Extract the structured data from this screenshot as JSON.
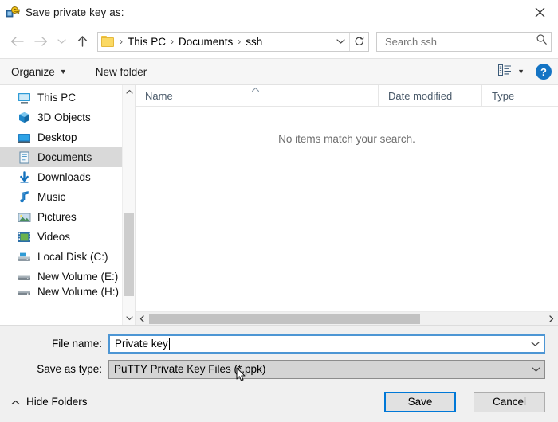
{
  "window": {
    "title": "Save private key as:",
    "icon": "key-icon",
    "close_label": "✕"
  },
  "nav": {
    "back": "←",
    "forward": "→",
    "recent": "⌄",
    "up": "↑",
    "refresh": "⟳",
    "dropdown": "⌄"
  },
  "breadcrumb": {
    "items": [
      "This PC",
      "Documents",
      "ssh"
    ],
    "separator": "›"
  },
  "search": {
    "placeholder": "Search ssh",
    "value": "",
    "icon": "search-icon"
  },
  "toolbar": {
    "organize_label": "Organize",
    "organize_caret": "▾",
    "new_folder_label": "New folder",
    "view_caret": "▾",
    "help_label": "?"
  },
  "sidebar": {
    "items": [
      {
        "label": "This PC",
        "icon": "monitor-icon",
        "selected": false
      },
      {
        "label": "3D Objects",
        "icon": "cube-icon",
        "selected": false
      },
      {
        "label": "Desktop",
        "icon": "desktop-icon",
        "selected": false
      },
      {
        "label": "Documents",
        "icon": "document-icon",
        "selected": true
      },
      {
        "label": "Downloads",
        "icon": "download-arrow-icon",
        "selected": false
      },
      {
        "label": "Music",
        "icon": "music-note-icon",
        "selected": false
      },
      {
        "label": "Pictures",
        "icon": "picture-icon",
        "selected": false
      },
      {
        "label": "Videos",
        "icon": "video-icon",
        "selected": false
      },
      {
        "label": "Local Disk (C:)",
        "icon": "hard-drive-icon",
        "selected": false
      },
      {
        "label": "New Volume (E:)",
        "icon": "drive-icon",
        "selected": false
      },
      {
        "label": "New Volume (H:)",
        "icon": "drive-icon",
        "selected": false
      }
    ],
    "scroll_up": "⌃",
    "scroll_down": "⌄"
  },
  "filelist": {
    "columns": [
      {
        "label": "Name",
        "sort": "ascending"
      },
      {
        "label": "Date modified",
        "sort": ""
      },
      {
        "label": "Type",
        "sort": ""
      }
    ],
    "sort_arrow": "⌃",
    "empty_message": "No items match your search.",
    "rows": [],
    "scroll_left": "‹",
    "scroll_right": "›"
  },
  "form": {
    "filename_label": "File name:",
    "filename_value": "Private key",
    "filetype_label": "Save as type:",
    "filetype_value": "PuTTY Private Key Files (*.ppk)",
    "dropdown_caret": "⌄"
  },
  "footer": {
    "hide_folders_label": "Hide Folders",
    "hide_folders_caret": "⌃",
    "save_label": "Save",
    "cancel_label": "Cancel"
  },
  "colors": {
    "accent": "#0078d7",
    "focus_border": "#4d96d4",
    "selection": "#d9d9d9",
    "help_blue": "#1474c4",
    "folder_yellow": "#fbd963"
  }
}
